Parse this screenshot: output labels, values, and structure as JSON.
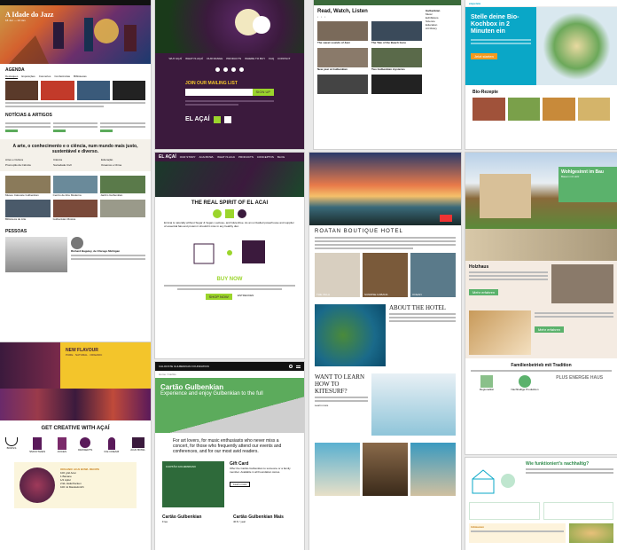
{
  "colors": {
    "gulbenkian_green": "#5cab5c",
    "acai_purple": "#3b1a3d",
    "acai_yellow": "#f3c52b",
    "acai_lime": "#9bd52c",
    "bio_teal": "#0aa7c7",
    "kitchen_blue": "#1e3f66",
    "hotel_dark": "#121212",
    "house_green": "#5bb26c"
  },
  "s1": {
    "hero_title": "A Idade do Jazz",
    "hero_sub": "18 Jun — 24 Jan",
    "tabs": [
      "Destaques",
      "Exposições",
      "Concertos",
      "Conferências",
      "Bibliotecas"
    ],
    "section_agenda": "AGENDA",
    "section_news": "NOTÍCIAS & ARTIGOS",
    "intro": "A arte, o conhecimento e o ciência, num mundo mais justo, sustentável e diverso.",
    "links": [
      "Artes e Cultura",
      "Ciência",
      "Educação",
      "Promoção da Ciência",
      "Sociedade Civil",
      "Oceanos e Clima"
    ],
    "gallery_labels": [
      "Museu Calouste Gulbenkian",
      "Centro de Arte Moderna",
      "Jardim Gulbenkian",
      "Biblioteca de Arte",
      "Gulbenkian Música"
    ],
    "bottom_title": "PESSOAS",
    "person_title": "Richard Baguley, de Chicago Michigan"
  },
  "s2": {
    "nav": [
      "WHY AÇAÍ",
      "WHAT IS AÇAÍ",
      "OUR RANGE",
      "PRODUCTS",
      "WHERE TO BUY",
      "FAQ",
      "CONTACT"
    ],
    "mailing": "JOIN OUR MAILING LIST",
    "signup": "SIGN UP",
    "logo": "EL AÇAÍ"
  },
  "s3": {
    "title": "Read, Watch, Listen",
    "sidebar": [
      "Gulbenkian",
      "Music",
      "Exhibitions",
      "Science",
      "Education",
      "Art library"
    ],
    "cards": [
      "The sweet sounds of Jazz",
      "The Tale of the Beach Guru",
      "New year at Gulbenkian",
      "Two Gulbenkian mysteries"
    ]
  },
  "s4": {
    "headline": "Stelle deine Bio-Kochbox in 2 Minuten ein",
    "cta": "Jetzt starten",
    "section": "Bio-Rezepte",
    "brand": "etepetete"
  },
  "s5": {
    "logo": "EL AÇAÍ",
    "nav": [
      "OUR STORY",
      "ACAI BOWL",
      "WHAT IS ACAI",
      "PRODUCTS",
      "CONCEPTOS",
      "BLOG"
    ],
    "headline": "THE REAL SPIRIT OF EL ACAI",
    "body": "El Acai is naturally without Sugar & Vegan, Lactose- and Glutenfree. As an unrivalled powerhouse and supplier of essential fats and protein it shouldn't miss in any healthy diet.",
    "buy": "BUY NOW",
    "buy_btn": "SHOP NOW",
    "learn": "ENTDECKEN"
  },
  "s6": {
    "hotel_title": "ROATAN BOUTIQUE HOTEL",
    "room_labels": [
      "THE VILLA",
      "SUNRISE CABANA",
      "OCEAN"
    ],
    "about": "ABOUT THE HOTEL",
    "kite_title": "WANT TO LEARN HOW TO KITESURF?",
    "learn": "Learn more"
  },
  "s7": {
    "headline": "Wohlgesinnt im Bau",
    "sub": "Bauen mit Holz",
    "cta": "Mehr erfahren",
    "section1": "Holzhaus",
    "section2": "Familienbetrieb mit Tradition",
    "features": [
      "Regionalität",
      "Nachhaltige Produktion",
      "PLUS ENERGIE HAUS"
    ],
    "plus": "PLUS ENERGIE HAUS"
  },
  "s8": {
    "banner1": "NEW FLAVOUR",
    "banner2": "PURE · NATURAL · ORGANIC",
    "title": "GET CREATIVE WITH AÇAÍ",
    "icons": [
      "BOWLS",
      "SMOOTHIES",
      "JUICES",
      "DESSERTS",
      "ICE CREAM",
      "ACAI BOWL"
    ],
    "recipe": "ORGANIC ACAI BOWL RECIPE",
    "ingredients": [
      "100 g El Acai",
      "1 Banane",
      "1/2 Apfel",
      "2 EL Haferflocken",
      "100 ml Mandelmilch"
    ]
  },
  "s9": {
    "brand": "CALOUSTE GULBENKIAN FOUNDATION",
    "crumb": "Home  /  Cartão",
    "title": "Cartão Gulbenkian",
    "subtitle": "Experience and enjoy Gulbenkian to the full",
    "intro": "For art lovers, for music enthusiasts who never miss a concert, for those who frequently attend our events and conferences, and for our most avid readers.",
    "gift_title": "Gift Card",
    "gift_body": "Offer the Cartão Gulbenkian to someone or a family member. Available in all Foundation stores.",
    "gift_btn": "Learn more",
    "card_label": "Cartão Gulbenkian",
    "card_sub": "Free",
    "card2_label": "Cartão Gulbenkian Mais",
    "card2_price": "40 € / year",
    "card_text": "CARTÃO GULBENKIAN"
  },
  "s10": {
    "headline": "Wie funktioniert's nachhaltig?",
    "section": "Infokasten"
  }
}
